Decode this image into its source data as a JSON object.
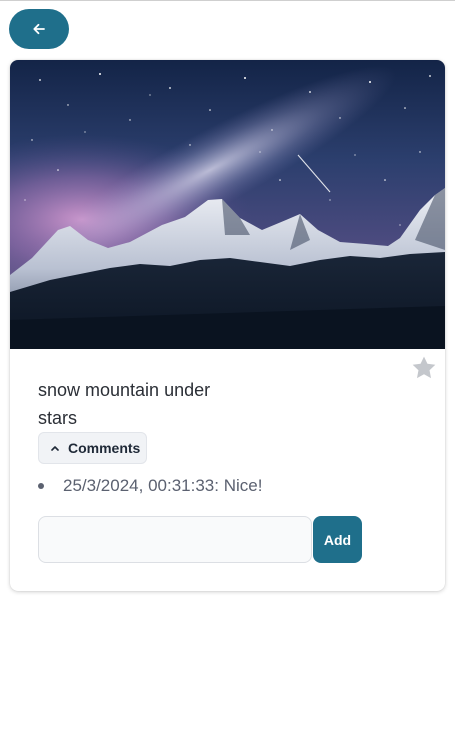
{
  "colors": {
    "accent": "#1f6f8b",
    "star": "#c4c7cc",
    "text": "#2b2f36",
    "muted_text": "#5b6170"
  },
  "header": {
    "back_icon": "arrow-left-icon"
  },
  "post": {
    "image_icon": "landscape-photo",
    "title": "snow mountain under stars",
    "favorite_icon": "star-icon",
    "comments_toggle": {
      "label": "Comments",
      "icon": "chevron-up-icon",
      "expanded": true
    },
    "comments": [
      {
        "text": "25/3/2024, 00:31:33: Nice!"
      }
    ],
    "new_comment": {
      "value": "",
      "placeholder": ""
    },
    "add_label": "Add"
  }
}
